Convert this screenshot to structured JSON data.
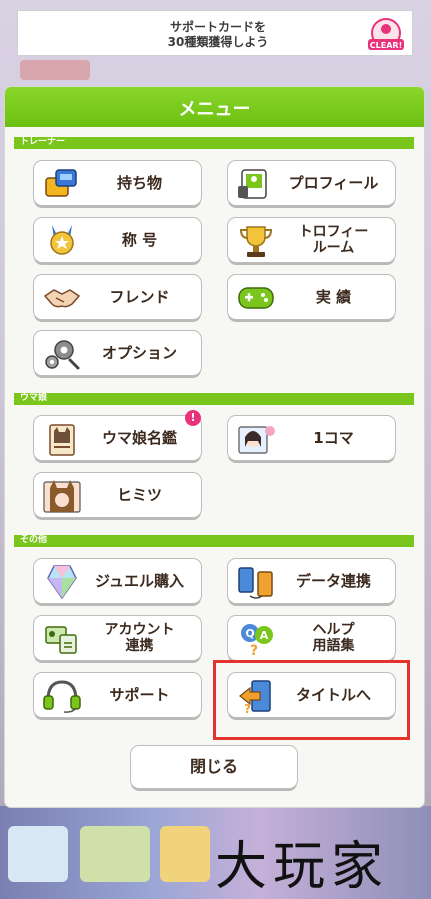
{
  "banner": {
    "text_line1": "サポートカードを",
    "text_line2": "30種類獲得しよう",
    "badge": "CLEAR!"
  },
  "menu": {
    "title": "メニュー"
  },
  "sections": [
    {
      "label": "トレーナー"
    },
    {
      "label": "ウマ娘"
    },
    {
      "label": "その他"
    }
  ],
  "buttons": {
    "items": "持ち物",
    "profile": "プロフィール",
    "title": "称 号",
    "trophy_line1": "トロフィー",
    "trophy_line2": "ルーム",
    "friend": "フレンド",
    "achievements": "実 績",
    "option": "オプション",
    "uma_encyclopedia": "ウマ娘名鑑",
    "one_koma": "1コマ",
    "himitsu": "ヒミツ",
    "jewel": "ジュエル購入",
    "data_link": "データ連携",
    "account_line1": "アカウント",
    "account_line2": "連携",
    "help_line1": "ヘルプ",
    "help_line2": "用語集",
    "support": "サポート",
    "to_title": "タイトルへ"
  },
  "new_badge": "!",
  "close": "閉じる",
  "watermark": "大玩家",
  "colors": {
    "accent_green": "#7bc61c",
    "highlight_red": "#e4322f",
    "badge_pink": "#e8327a"
  }
}
